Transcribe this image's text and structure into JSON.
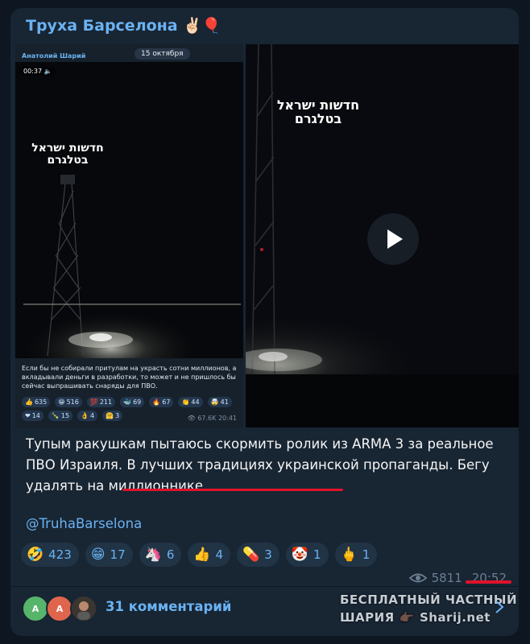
{
  "channel": {
    "title": "Труха Барселона ✌🏻🎈"
  },
  "embedded_post": {
    "date": "15 октября",
    "author": "Анатолий Шарий",
    "video_time": "00:37 🔈",
    "hebrew_line1": "חדשות ישראל",
    "hebrew_line2": "בטלגרם",
    "caption": "Если бы не собирали притулам на украсть сотни миллионов, а вкладывали деньги в разработки, то может и не пришлось бы сейчас выпрашивать снаряды для ПВО.",
    "reactions_row1": [
      {
        "emoji": "👍",
        "count": "635"
      },
      {
        "emoji": "😁",
        "count": "516"
      },
      {
        "emoji": "💯",
        "count": "211"
      },
      {
        "emoji": "🐳",
        "count": "69"
      },
      {
        "emoji": "🔥",
        "count": "67"
      },
      {
        "emoji": "👏",
        "count": "44"
      },
      {
        "emoji": "🤯",
        "count": "41"
      }
    ],
    "reactions_row2": [
      {
        "emoji": "❤",
        "count": "14"
      },
      {
        "emoji": "🍾",
        "count": "15"
      },
      {
        "emoji": "👌",
        "count": "4"
      },
      {
        "emoji": "🤗",
        "count": "3"
      }
    ],
    "views": "👁 67.6K",
    "time": "20:41"
  },
  "video": {
    "hebrew_line1": "חדשות ישראל",
    "hebrew_line2": "בטלגרם"
  },
  "message": {
    "text_part1": "Тупым ракушкам пытаюсь скормить ролик из ARMA 3 за реальное ПВО Израиля. В лучших традициях украинской пропаганды. ",
    "text_underlined": "Бегу удалять на миллионнике",
    "handle": "@TruhaBarselona"
  },
  "reactions": [
    {
      "emoji": "🤣",
      "count": "423"
    },
    {
      "emoji": "😁",
      "count": "17"
    },
    {
      "emoji": "🦄",
      "count": "6"
    },
    {
      "emoji": "👍",
      "count": "4"
    },
    {
      "emoji": "💊",
      "count": "3"
    },
    {
      "emoji": "🤡",
      "count": "1"
    },
    {
      "emoji": "🖕",
      "count": "1"
    }
  ],
  "meta": {
    "views": "5811",
    "time": "20:52"
  },
  "comments": {
    "label": "31 комментарий",
    "avatars": [
      {
        "letter": "А",
        "color": "#56b46b"
      },
      {
        "letter": "А",
        "color": "#e0654d"
      },
      {
        "letter": "",
        "color": "#4a4a4a"
      }
    ]
  },
  "watermark": {
    "line1": "БЕСПЛАТНЫЙ ЧАСТНЫЙ",
    "line2a": "ШАРИЯ",
    "line2b": "Sharij.net"
  },
  "colors": {
    "bubble": "#182533",
    "accent": "#6ab2f2",
    "highlight": "#e1122c"
  }
}
